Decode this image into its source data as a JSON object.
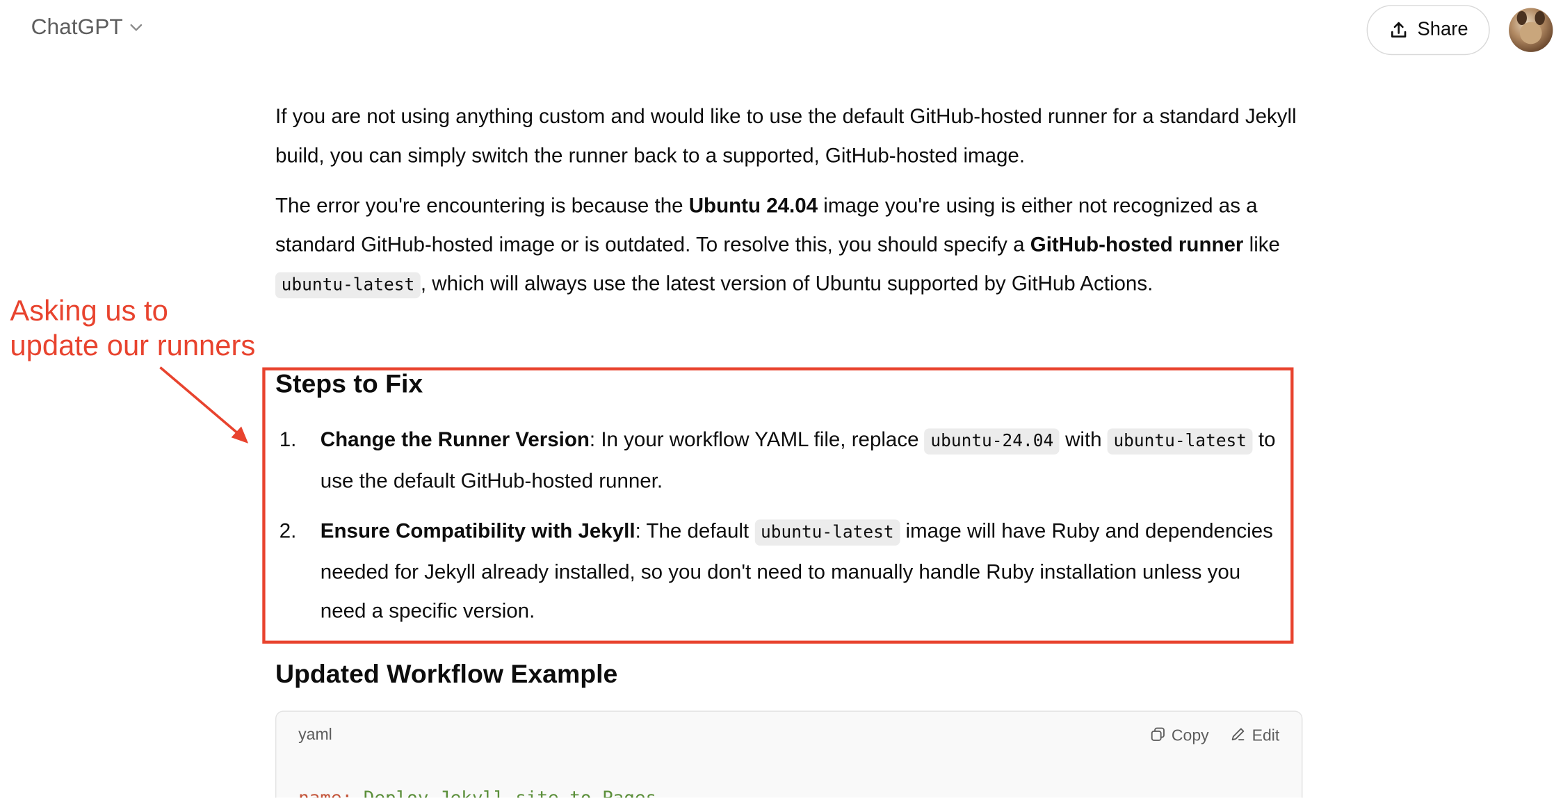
{
  "header": {
    "model_label": "ChatGPT",
    "model_chevron_icon": "chevron-down-icon",
    "share_label": "Share",
    "share_icon": "share-upload-icon"
  },
  "message": {
    "p1": "If you are not using anything custom and would like to use the default GitHub-hosted runner for a standard Jekyll build, you can simply switch the runner back to a supported, GitHub-hosted image.",
    "p2": {
      "t1": "The error you're encountering is because the ",
      "b1": "Ubuntu 24.04",
      "t2": " image you're using is either not recognized as a standard GitHub-hosted image or is outdated. To resolve this, you should specify a ",
      "b2": "GitHub-hosted runner",
      "t3": " like ",
      "c1": "ubuntu-latest",
      "t4": ", which will always use the latest version of Ubuntu supported by GitHub Actions."
    },
    "steps_heading": "Steps to Fix",
    "steps": [
      {
        "num": "1.",
        "bold": "Change the Runner Version",
        "t1": ": In your workflow YAML file, replace ",
        "c1": "ubuntu-24.04",
        "t2": " with ",
        "c2": "ubuntu-latest",
        "t3": " to use the default GitHub-hosted runner."
      },
      {
        "num": "2.",
        "bold": "Ensure Compatibility with Jekyll",
        "t1": ": The default ",
        "c1": "ubuntu-latest",
        "t2": " image will have Ruby and dependencies needed for Jekyll already installed, so you don't need to manually handle Ruby installation unless you need a specific version."
      }
    ],
    "workflow_heading": "Updated Workflow Example",
    "code": {
      "lang": "yaml",
      "copy_label": "Copy",
      "edit_label": "Edit",
      "line1_key": "name:",
      "line1_val": "Deploy Jekyll site to Pages"
    }
  },
  "annotation": {
    "text": "Asking us to\nupdate our runners",
    "color": "#e8432e"
  }
}
